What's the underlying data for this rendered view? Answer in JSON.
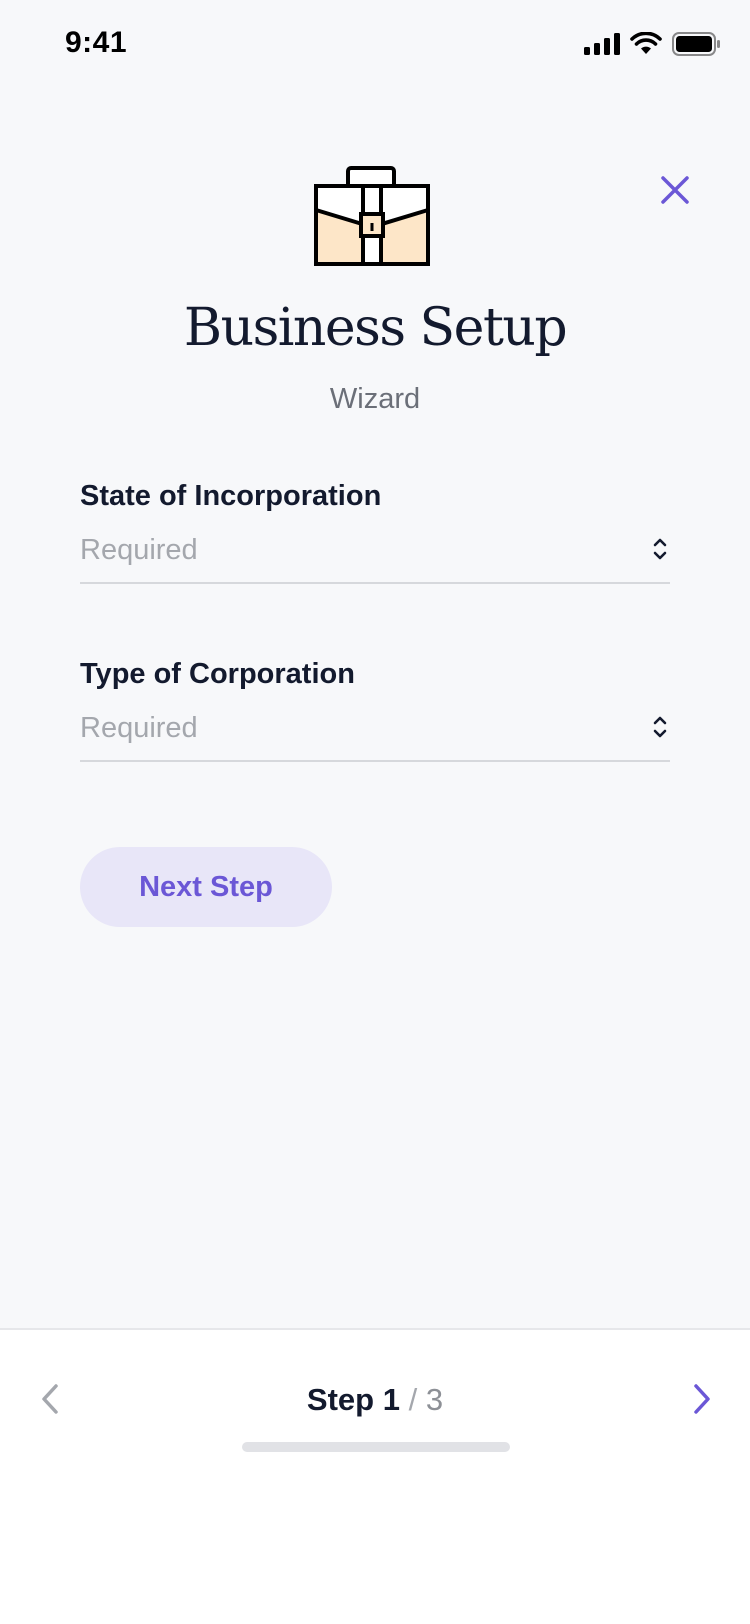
{
  "status_bar": {
    "time": "9:41",
    "icons": [
      "signal-icon",
      "wifi-icon",
      "battery-icon"
    ]
  },
  "header": {
    "icon": "briefcase-icon",
    "title": "Business Setup",
    "subtitle": "Wizard",
    "close_icon": "close-icon"
  },
  "form": {
    "fields": [
      {
        "label": "State of Incorporation",
        "value": "Required"
      },
      {
        "label": "Type of Corporation",
        "value": "Required"
      }
    ],
    "next_label": "Next Step"
  },
  "footer": {
    "step_word": "Step",
    "current": "1",
    "separator": "/",
    "total": "3",
    "prev_icon": "chevron-left-icon",
    "next_icon": "chevron-right-icon"
  },
  "colors": {
    "accent": "#6b57d6",
    "accent_soft": "#e8e6f8",
    "background": "#f7f8fa",
    "briefcase_fill": "#fde6c8",
    "text_primary": "#131a2e",
    "placeholder": "#a4a7ad"
  }
}
